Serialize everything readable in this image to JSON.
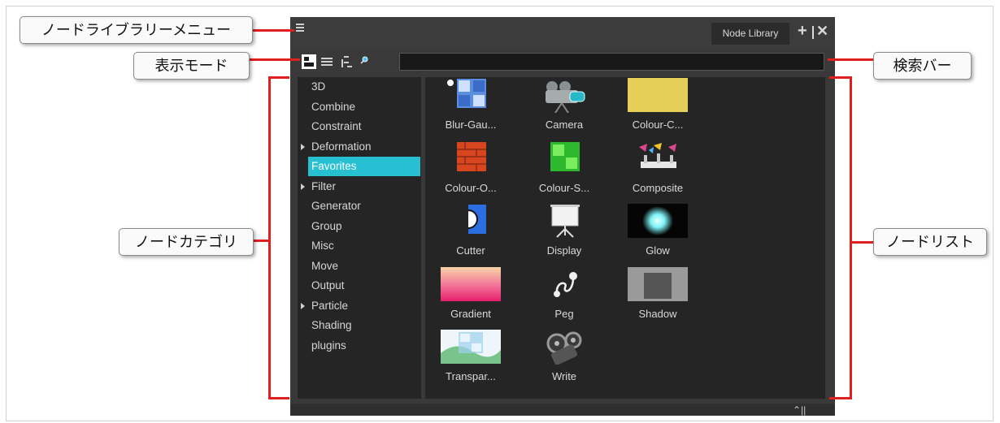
{
  "panel": {
    "tab_title": "Node Library",
    "search": {
      "value": "",
      "placeholder": ""
    },
    "accent_color": "#27bfd2"
  },
  "categories": [
    {
      "label": "3D",
      "expandable": false
    },
    {
      "label": "Combine",
      "expandable": false
    },
    {
      "label": "Constraint",
      "expandable": false
    },
    {
      "label": "Deformation",
      "expandable": true
    },
    {
      "label": "Favorites",
      "expandable": false,
      "selected": true
    },
    {
      "label": "Filter",
      "expandable": true
    },
    {
      "label": "Generator",
      "expandable": false
    },
    {
      "label": "Group",
      "expandable": false
    },
    {
      "label": "Misc",
      "expandable": false
    },
    {
      "label": "Move",
      "expandable": false
    },
    {
      "label": "Output",
      "expandable": false
    },
    {
      "label": "Particle",
      "expandable": true
    },
    {
      "label": "Shading",
      "expandable": false
    },
    {
      "label": "plugins",
      "expandable": false
    }
  ],
  "nodes": [
    {
      "label": "Blur-Gau...",
      "icon": "blur-gaussian-icon"
    },
    {
      "label": "Camera",
      "icon": "camera-icon"
    },
    {
      "label": "Colour-C...",
      "icon": "colour-card-icon"
    },
    {
      "label": "Colour-O...",
      "icon": "colour-override-icon"
    },
    {
      "label": "Colour-S...",
      "icon": "colour-scale-icon"
    },
    {
      "label": "Composite",
      "icon": "composite-icon"
    },
    {
      "label": "Cutter",
      "icon": "cutter-icon"
    },
    {
      "label": "Display",
      "icon": "display-icon"
    },
    {
      "label": "Glow",
      "icon": "glow-icon"
    },
    {
      "label": "Gradient",
      "icon": "gradient-icon"
    },
    {
      "label": "Peg",
      "icon": "peg-icon"
    },
    {
      "label": "Shadow",
      "icon": "shadow-icon"
    },
    {
      "label": "Transpar...",
      "icon": "transparency-icon"
    },
    {
      "label": "Write",
      "icon": "write-icon"
    }
  ],
  "callouts": {
    "menu": "ノードライブラリーメニュー",
    "view_mode": "表示モード",
    "category": "ノードカテゴリ",
    "search_bar": "検索バー",
    "node_list": "ノードリスト"
  },
  "callout_line_color": "#e0201f"
}
